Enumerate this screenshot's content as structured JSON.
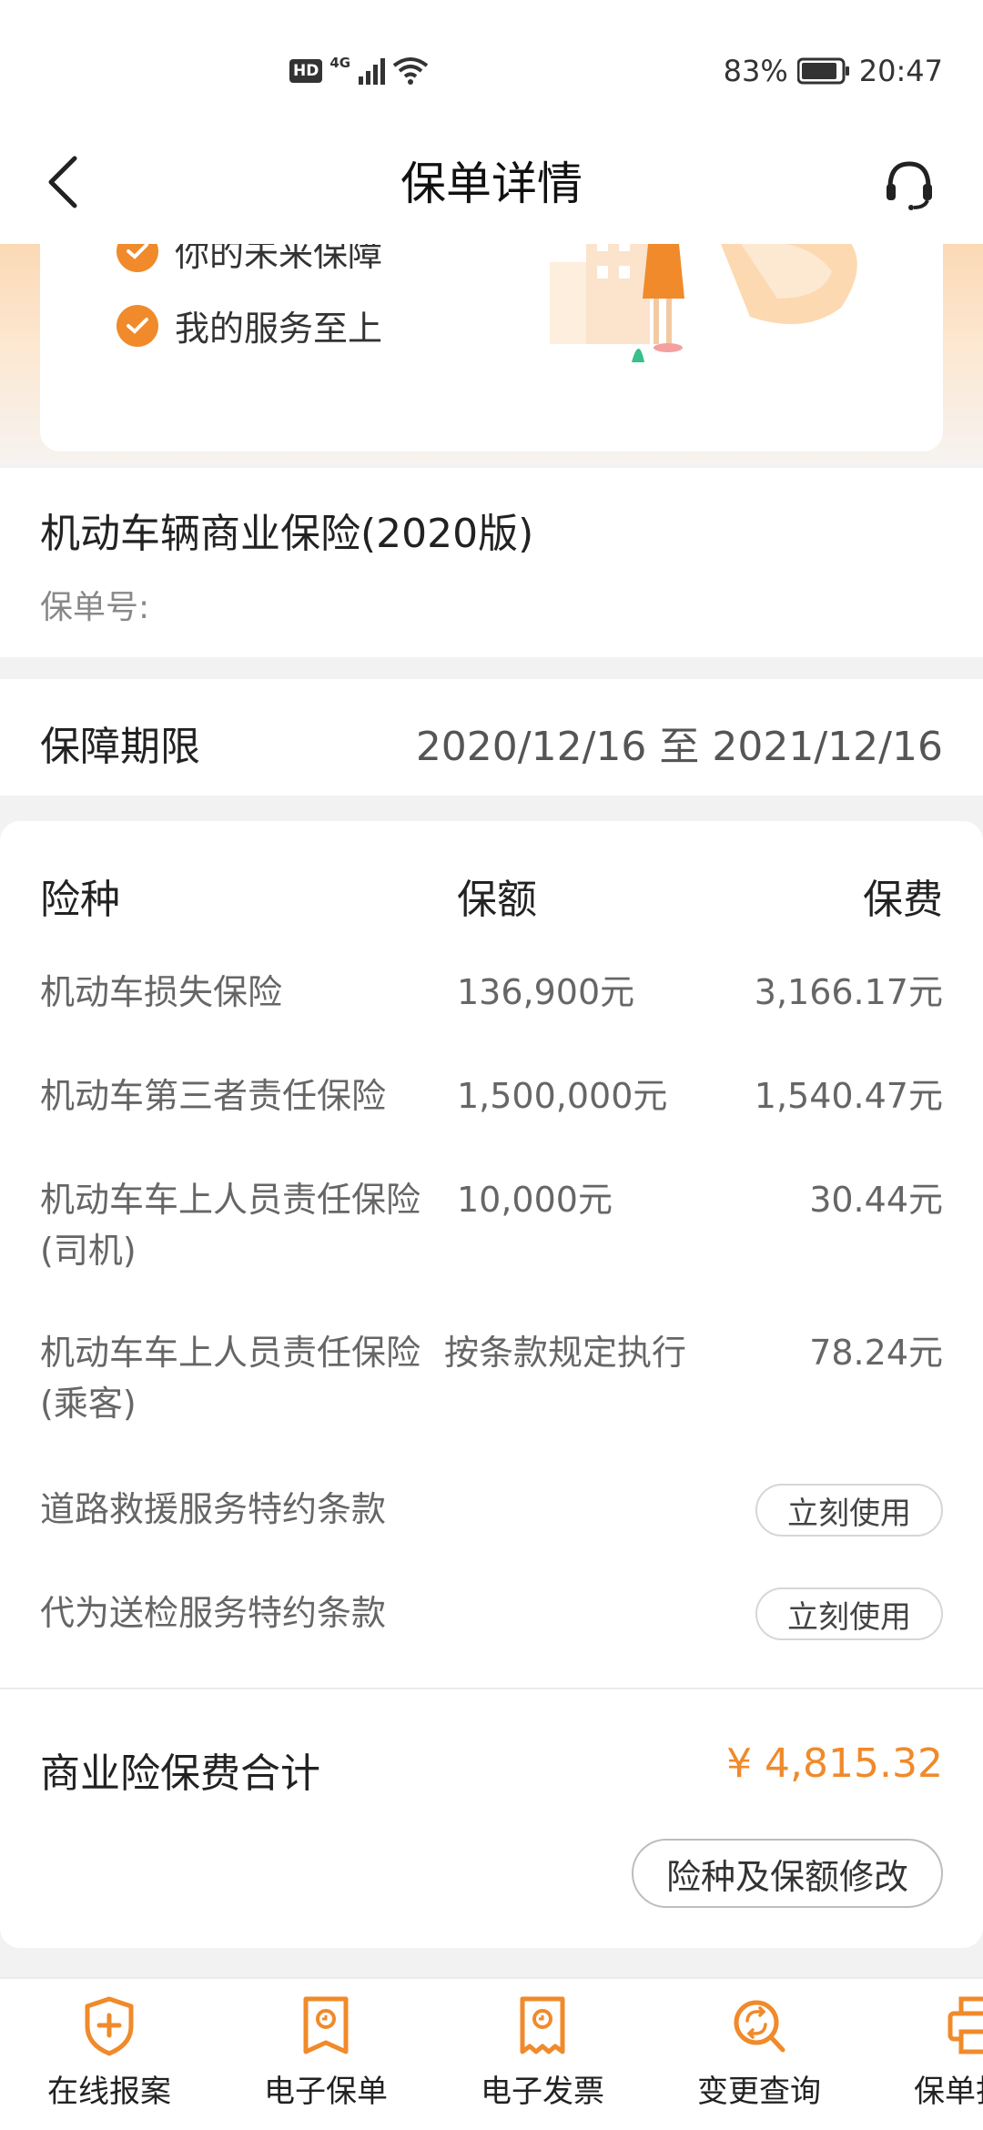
{
  "status_bar": {
    "hd": "HD",
    "network": "4G",
    "battery": "83%",
    "time": "20:47"
  },
  "header": {
    "title": "保单详情"
  },
  "banner": {
    "lines": [
      "你的未来保障",
      "我的服务至上"
    ]
  },
  "policy": {
    "name": "机动车辆商业保险(2020版)",
    "number_label": "保单号:"
  },
  "period": {
    "label": "保障期限",
    "value": "2020/12/16 至 2021/12/16"
  },
  "coverage": {
    "headers": {
      "type": "险种",
      "amount": "保额",
      "premium": "保费"
    },
    "rows": [
      {
        "name": "机动车损失保险",
        "amount": "136,900元",
        "premium": "3,166.17元"
      },
      {
        "name": "机动车第三者责任保险",
        "amount": "1,500,000元",
        "premium": "1,540.47元"
      },
      {
        "name": "机动车车上人员责任保险(司机)",
        "amount": "10,000元",
        "premium": "30.44元"
      },
      {
        "name": "机动车车上人员责任保险(乘客)",
        "amount": "按条款规定执行",
        "premium": "78.24元"
      }
    ],
    "services": [
      {
        "name": "道路救援服务特约条款",
        "button": "立刻使用"
      },
      {
        "name": "代为送检服务特约条款",
        "button": "立刻使用"
      }
    ],
    "total_label": "商业险保费合计",
    "total_value": "¥ 4,815.32",
    "modify_button": "险种及保额修改"
  },
  "bottom_nav": {
    "items": [
      {
        "label": "在线报案",
        "icon": "shield-plus-icon"
      },
      {
        "label": "电子保单",
        "icon": "policy-document-icon"
      },
      {
        "label": "电子发票",
        "icon": "invoice-icon"
      },
      {
        "label": "变更查询",
        "icon": "change-search-icon"
      },
      {
        "label": "保单打印",
        "icon": "printer-icon"
      }
    ]
  },
  "colors": {
    "accent": "#f08a2a",
    "background": "#f2f2f2"
  }
}
